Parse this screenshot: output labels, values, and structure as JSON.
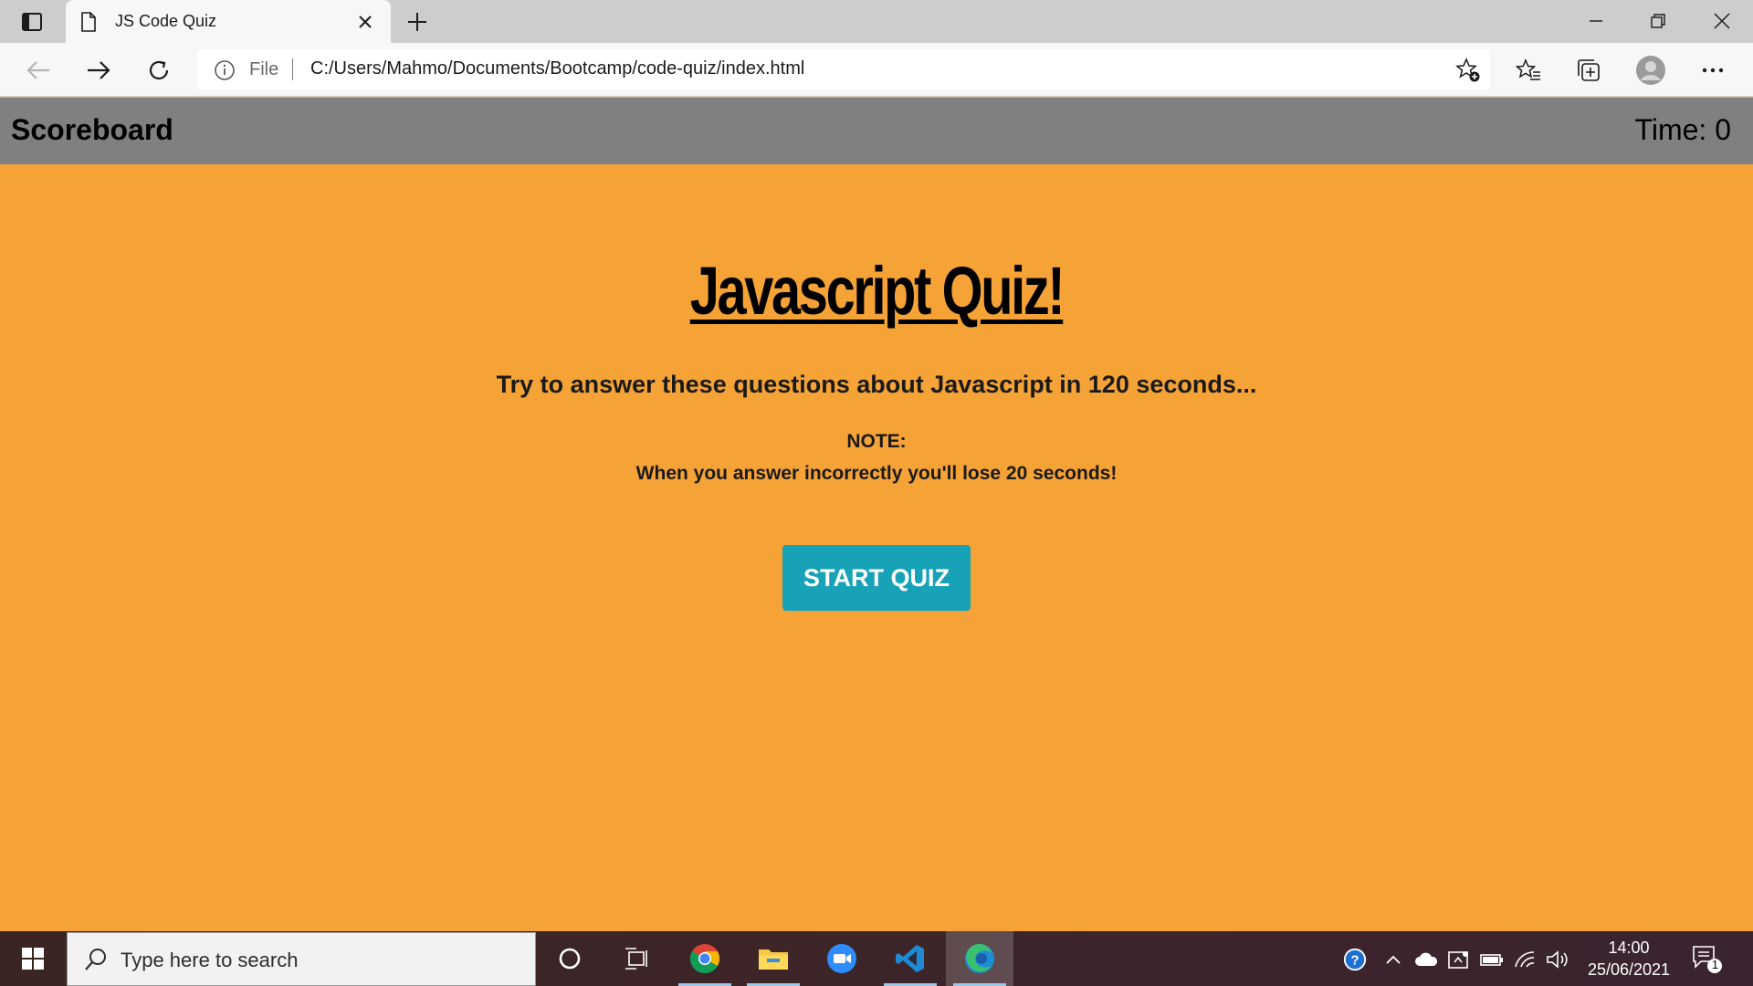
{
  "browser": {
    "tab_title": "JS Code Quiz",
    "address_scheme": "File",
    "address_url": "C:/Users/Mahmo/Documents/Bootcamp/code-quiz/index.html"
  },
  "page": {
    "header": {
      "scoreboard_label": "Scoreboard",
      "timer_text": "Time: 0"
    },
    "title": "Javascript Quiz!",
    "intro": "Try to answer these questions about Javascript in 120 seconds...",
    "note_label": "NOTE:",
    "note_text": "When you answer incorrectly you'll lose 20 seconds!",
    "start_button": "START QUIZ"
  },
  "taskbar": {
    "search_placeholder": "Type here to search",
    "clock_time": "14:00",
    "clock_date": "25/06/2021",
    "notification_count": "1",
    "apps": [
      "cortana-icon",
      "task-view-icon",
      "chrome-icon",
      "file-explorer-icon",
      "zoom-icon",
      "vscode-icon",
      "edge-icon"
    ]
  },
  "colors": {
    "page_background": "#f5a236",
    "header_background": "#808080",
    "start_button": "#17a2b8"
  }
}
